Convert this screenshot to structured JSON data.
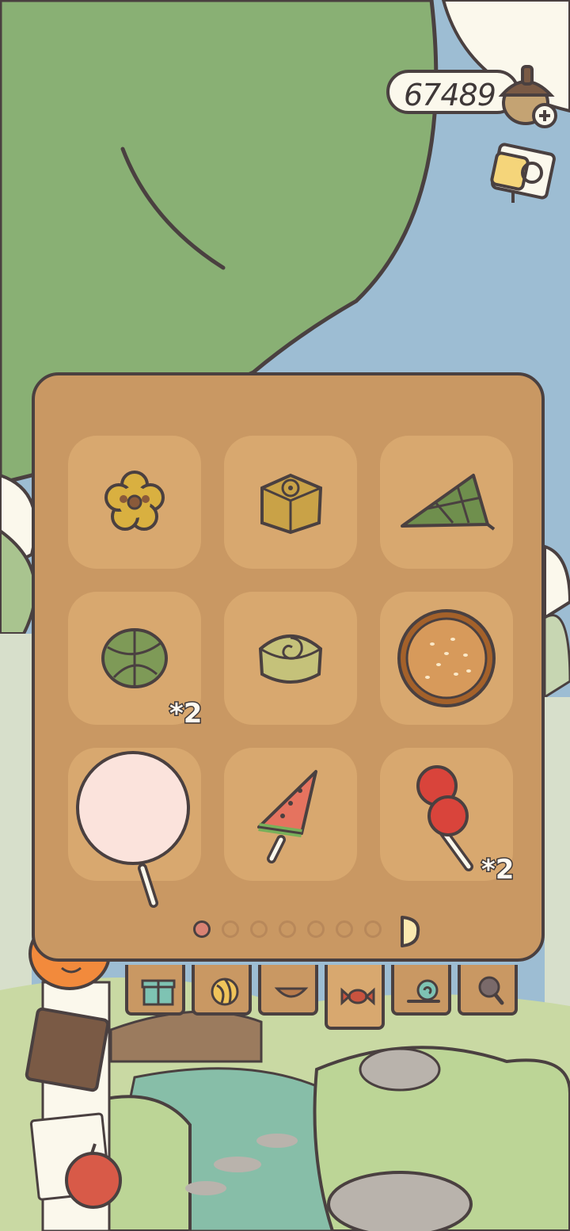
{
  "currency": {
    "amount": "67489",
    "icon": "acorn-icon",
    "add_icon": "plus-icon"
  },
  "top_buttons": [
    {
      "icon": "note-icon"
    }
  ],
  "inventory": {
    "items": [
      {
        "icon": "plum-blossom-mooncake-icon",
        "count": ""
      },
      {
        "icon": "square-mooncake-icon",
        "count": ""
      },
      {
        "icon": "zongzi-icon",
        "count": ""
      },
      {
        "icon": "round-zongzi-icon",
        "count": "*2"
      },
      {
        "icon": "swirl-mooncake-icon",
        "count": ""
      },
      {
        "icon": "sesame-pie-icon",
        "count": ""
      },
      {
        "icon": "cotton-candy-icon",
        "count": ""
      },
      {
        "icon": "watermelon-popsicle-icon",
        "count": ""
      },
      {
        "icon": "candied-hawthorn-icon",
        "count": "*2"
      }
    ],
    "pagination": {
      "current_page": 1,
      "total_pages": 7
    }
  },
  "tabs": [
    {
      "icon": "gift-icon",
      "active": false
    },
    {
      "icon": "yarn-icon",
      "active": false
    },
    {
      "icon": "bowl-icon",
      "active": false
    },
    {
      "icon": "candy-icon",
      "active": true
    },
    {
      "icon": "snail-icon",
      "active": false
    },
    {
      "icon": "magnifier-icon",
      "active": false
    }
  ],
  "colors": {
    "panel": "#c99863",
    "slot": "#d8a86f",
    "outline": "#4a4040",
    "page_dot_active": "#d98273"
  }
}
